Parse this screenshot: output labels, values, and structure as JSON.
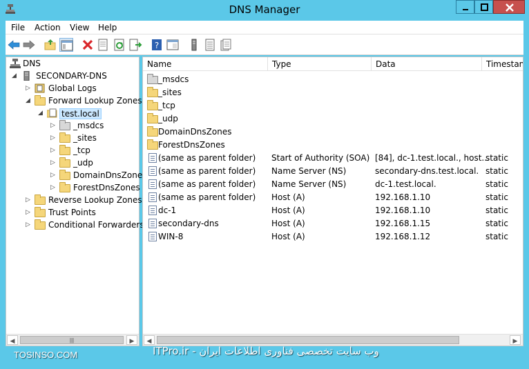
{
  "window": {
    "title": "DNS Manager",
    "accent": "#5bc8e8"
  },
  "menu": [
    "File",
    "Action",
    "View",
    "Help"
  ],
  "toolbar_icons": [
    "back-arrow-icon",
    "forward-arrow-icon",
    "up-folder-icon",
    "show-hide-console-tree-icon",
    "delete-icon",
    "properties-icon",
    "refresh-icon",
    "export-list-icon",
    "help-icon",
    "console-pane-icon",
    "server-icon",
    "records-icon",
    "zone-icon"
  ],
  "tree": {
    "root": "DNS",
    "server": "SECONDARY-DNS",
    "items": [
      {
        "label": "Global Logs"
      },
      {
        "label": "Forward Lookup Zones"
      },
      {
        "label": "test.local"
      },
      {
        "label": "_msdcs"
      },
      {
        "label": "_sites"
      },
      {
        "label": "_tcp"
      },
      {
        "label": "_udp"
      },
      {
        "label": "DomainDnsZones"
      },
      {
        "label": "ForestDnsZones"
      },
      {
        "label": "Reverse Lookup Zones"
      },
      {
        "label": "Trust Points"
      },
      {
        "label": "Conditional Forwarders"
      }
    ]
  },
  "list": {
    "columns": [
      "Name",
      "Type",
      "Data",
      "Timestam"
    ],
    "rows": [
      {
        "name": "_msdcs",
        "type": "",
        "data": "",
        "timestamp": "",
        "icon": "gray-folder-icon"
      },
      {
        "name": "_sites",
        "type": "",
        "data": "",
        "timestamp": "",
        "icon": "folder-icon"
      },
      {
        "name": "_tcp",
        "type": "",
        "data": "",
        "timestamp": "",
        "icon": "folder-icon"
      },
      {
        "name": "_udp",
        "type": "",
        "data": "",
        "timestamp": "",
        "icon": "folder-icon"
      },
      {
        "name": "DomainDnsZones",
        "type": "",
        "data": "",
        "timestamp": "",
        "icon": "folder-icon"
      },
      {
        "name": "ForestDnsZones",
        "type": "",
        "data": "",
        "timestamp": "",
        "icon": "folder-icon"
      },
      {
        "name": "(same as parent folder)",
        "type": "Start of Authority (SOA)",
        "data": "[84], dc-1.test.local., host...",
        "timestamp": "static",
        "icon": "record-icon"
      },
      {
        "name": "(same as parent folder)",
        "type": "Name Server (NS)",
        "data": "secondary-dns.test.local.",
        "timestamp": "static",
        "icon": "record-icon"
      },
      {
        "name": "(same as parent folder)",
        "type": "Name Server (NS)",
        "data": "dc-1.test.local.",
        "timestamp": "static",
        "icon": "record-icon"
      },
      {
        "name": "(same as parent folder)",
        "type": "Host (A)",
        "data": "192.168.1.10",
        "timestamp": "static",
        "icon": "record-icon"
      },
      {
        "name": "dc-1",
        "type": "Host (A)",
        "data": "192.168.1.10",
        "timestamp": "static",
        "icon": "record-icon"
      },
      {
        "name": "secondary-dns",
        "type": "Host (A)",
        "data": "192.168.1.15",
        "timestamp": "static",
        "icon": "record-icon"
      },
      {
        "name": "WIN-8",
        "type": "Host (A)",
        "data": "192.168.1.12",
        "timestamp": "static",
        "icon": "record-icon"
      }
    ]
  },
  "watermark": {
    "left": "TOSINSO.COM",
    "right": "وب سایت تخصصی فناوری اطلاعات ایران - ITPro.ir"
  }
}
